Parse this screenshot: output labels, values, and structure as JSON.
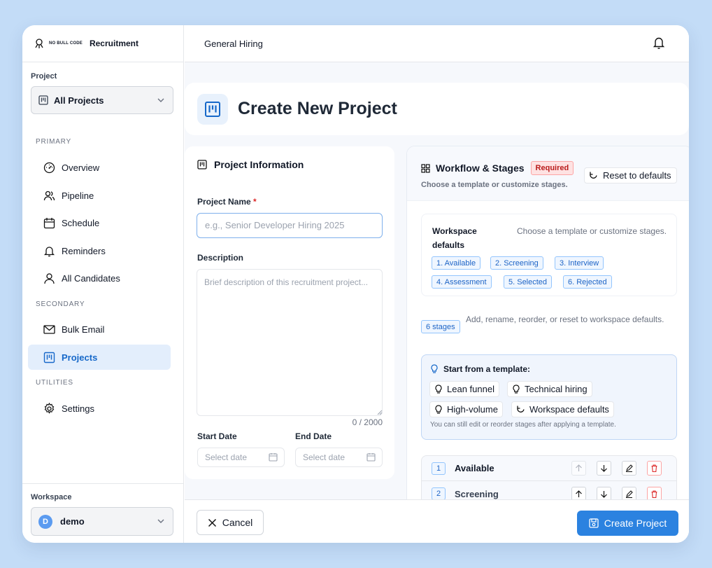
{
  "brand": {
    "logo_text": "NO BULL CODE",
    "app_title": "Recruitment"
  },
  "sidebar": {
    "project_label": "Project",
    "project_select": "All Projects",
    "groups": {
      "primary": "PRIMARY",
      "secondary": "SECONDARY",
      "utilities": "UTILITIES"
    },
    "items": [
      {
        "label": "Overview",
        "icon": "gauge-icon"
      },
      {
        "label": "Pipeline",
        "icon": "users-icon"
      },
      {
        "label": "Schedule",
        "icon": "calendar-icon"
      },
      {
        "label": "Reminders",
        "icon": "bell-icon"
      },
      {
        "label": "All Candidates",
        "icon": "user-icon"
      },
      {
        "label": "Bulk Email",
        "icon": "mail-icon"
      },
      {
        "label": "Projects",
        "icon": "kanban-icon",
        "active": true
      },
      {
        "label": "Settings",
        "icon": "gear-icon"
      }
    ],
    "workspace_label": "Workspace",
    "workspace": {
      "initial": "D",
      "name": "demo"
    }
  },
  "topbar": {
    "title": "General Hiring"
  },
  "page": {
    "title": "Create New Project"
  },
  "project_info": {
    "heading": "Project Information",
    "name_label": "Project Name",
    "required_mark": "*",
    "name_placeholder": "e.g., Senior Developer Hiring 2025",
    "desc_label": "Description",
    "desc_placeholder": "Brief description of this recruitment project...",
    "counter": "0 / 2000",
    "start_label": "Start Date",
    "end_label": "End Date",
    "date_placeholder": "Select date"
  },
  "workflow": {
    "heading": "Workflow & Stages",
    "required_badge": "Required",
    "subtitle": "Choose a template or customize stages.",
    "reset_label": "Reset to defaults",
    "ws_defaults_title": "Workspace defaults",
    "ws_defaults_desc": "Choose a template or customize stages.",
    "default_chips": [
      "1. Available",
      "2. Screening",
      "3. Interview",
      "4. Assessment",
      "5. Selected",
      "6. Rejected"
    ],
    "stage_count": "6 stages",
    "stage_hint": "Add, rename, reorder, or reset to workspace defaults.",
    "template_title": "Start from a template:",
    "templates": [
      "Lean funnel",
      "Technical hiring",
      "High-volume",
      "Workspace defaults"
    ],
    "template_note": "You can still edit or reorder stages after applying a template.",
    "stages": [
      {
        "num": "1",
        "name": "Available"
      },
      {
        "num": "2",
        "name": "Screening"
      }
    ]
  },
  "footer": {
    "cancel": "Cancel",
    "create": "Create Project"
  },
  "colors": {
    "accent": "#2b82e0",
    "active_bg": "#e3eefc",
    "required": "#dc2626"
  }
}
